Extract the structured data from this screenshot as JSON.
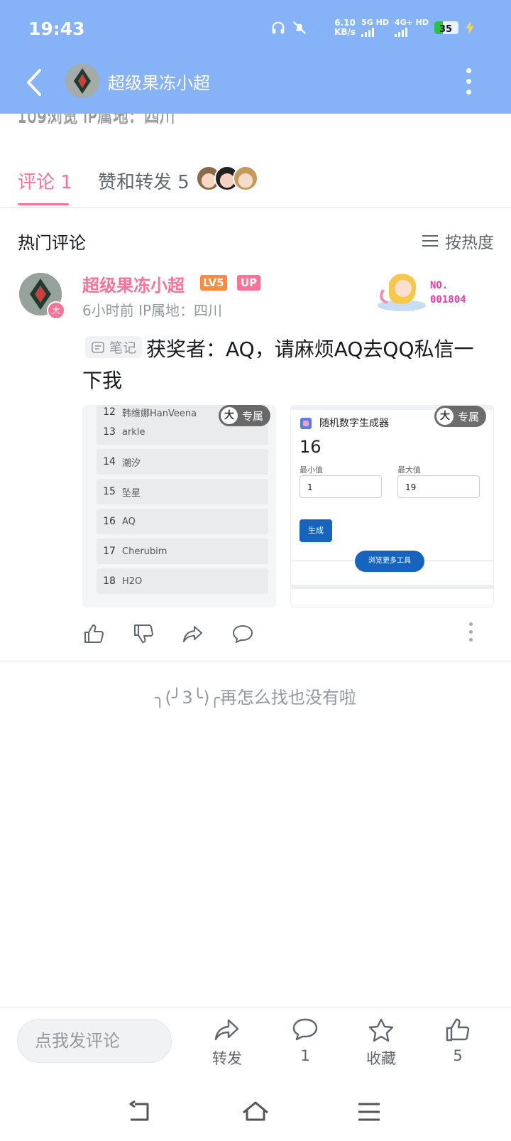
{
  "status_bar": {
    "time": "19:43",
    "speed": "6.10",
    "speed_unit": "KB/s",
    "net1": "5G HD",
    "net2": "4G+ HD",
    "battery": "35"
  },
  "header": {
    "title": "超级果冻小超"
  },
  "post_peek": "109浏览  IP属地：四川",
  "tabs": {
    "comments": "评论 1",
    "likes": "赞和转发 5"
  },
  "section_title": "热门评论",
  "sort_label": "按热度",
  "comment": {
    "author": "超级果冻小超",
    "level": "LV5",
    "up_badge": "UP",
    "meta": "6小时前  IP属地：四川",
    "fan_no_label": "NO.",
    "fan_no_value": "001804",
    "avatar_badge": "大",
    "note_tag": "笔记",
    "text": "获奖者：AQ，请麻烦AQ去QQ私信一下我"
  },
  "image_left": {
    "exclusive_badge_char": "大",
    "exclusive_label": "专属",
    "rows": [
      {
        "num": "12",
        "name": "韩维娜HanVeena"
      },
      {
        "num": "13",
        "name": "arkle"
      },
      {
        "num": "14",
        "name": "潮汐"
      },
      {
        "num": "15",
        "name": "坠星"
      },
      {
        "num": "16",
        "name": "AQ"
      },
      {
        "num": "17",
        "name": "Cherubim"
      },
      {
        "num": "18",
        "name": "H2O"
      }
    ]
  },
  "image_right": {
    "exclusive_badge_char": "大",
    "exclusive_label": "专属",
    "tool_name": "随机数字生成器",
    "result": "16",
    "min_label": "最小值",
    "max_label": "最大值",
    "min_value": "1",
    "max_value": "19",
    "generate_button": "生成",
    "more_tools": "浏览更多工具"
  },
  "end_text": "╮(╯3╰)╭再怎么找也没有啦",
  "bottom_bar": {
    "input_placeholder": "点我发评论",
    "share": "转发",
    "comments": "1",
    "favorite": "收藏",
    "likes": "5"
  },
  "colors": {
    "header_bg": "#86b3f7",
    "accent_pink": "#fb7299",
    "text_gray": "#9499a0"
  }
}
